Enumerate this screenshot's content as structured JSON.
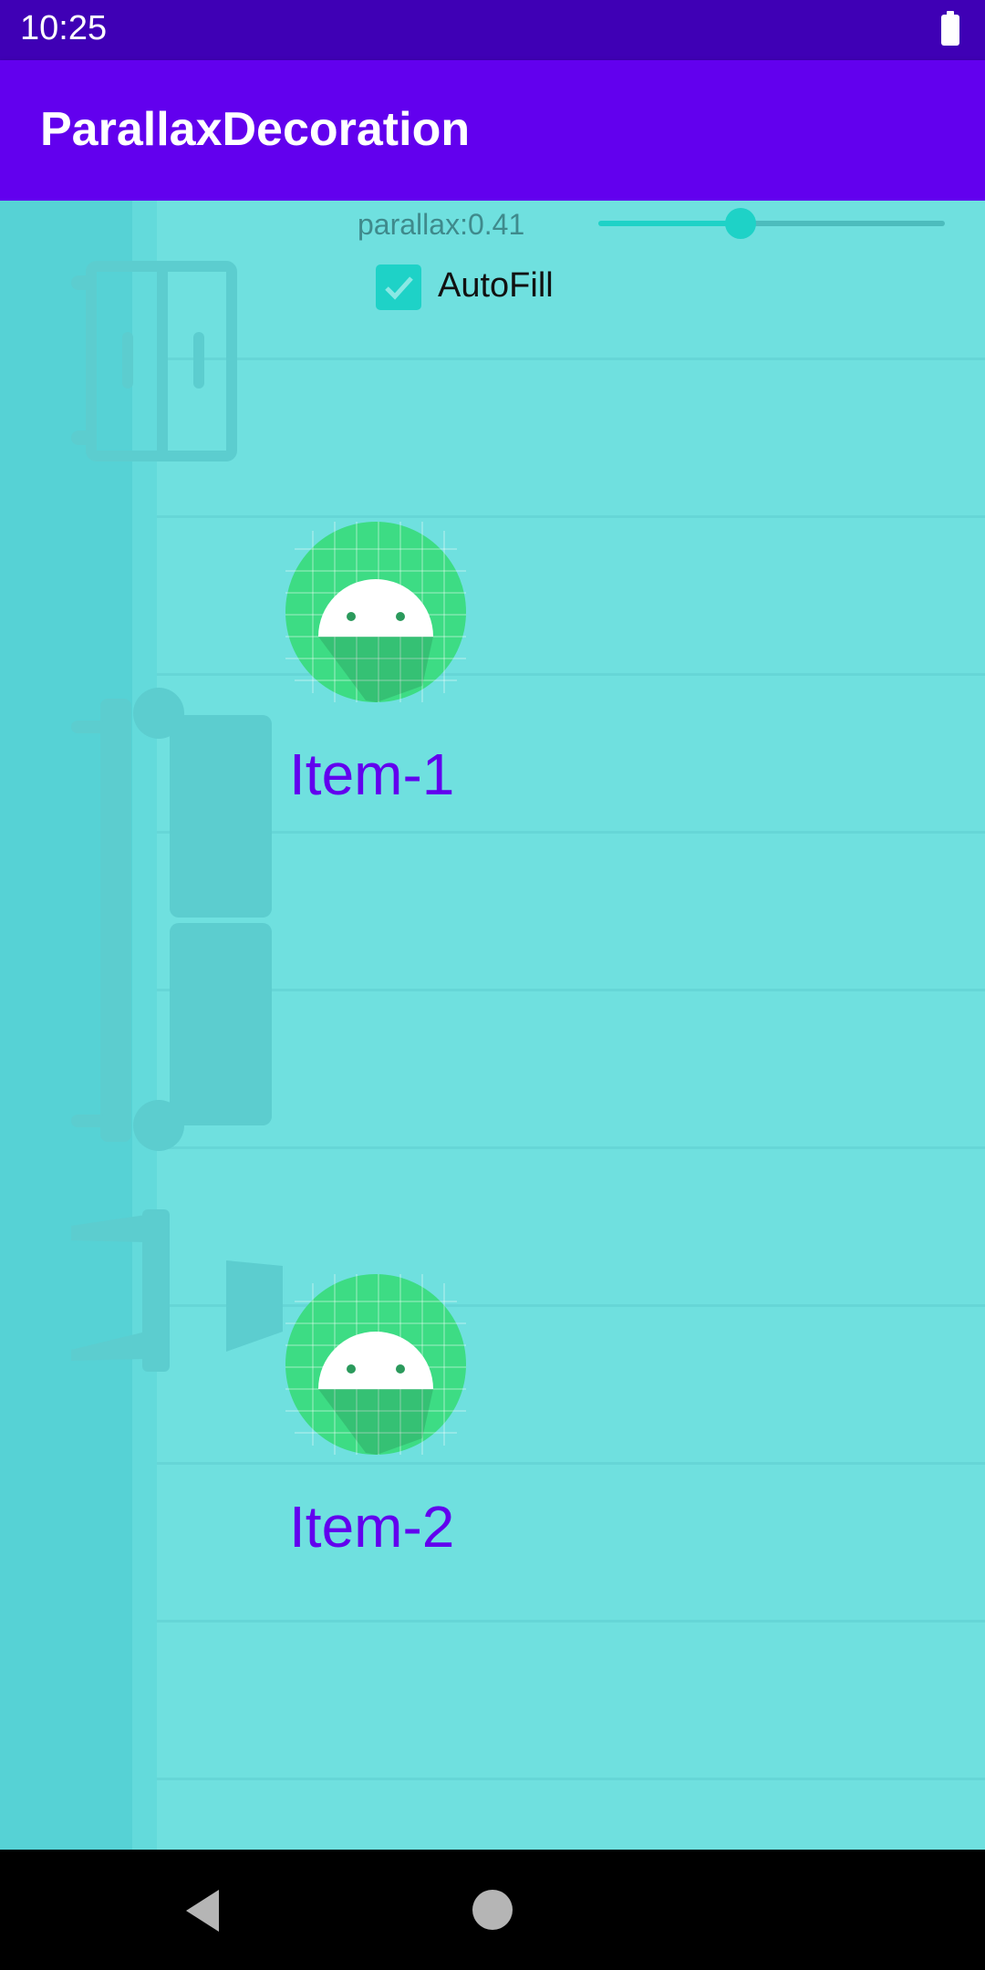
{
  "status_bar": {
    "time": "10:25"
  },
  "app_bar": {
    "title": "ParallaxDecoration"
  },
  "controls": {
    "parallax_label": "parallax:0.41",
    "parallax_value": 0.41,
    "autofill_label": "AutoFill",
    "autofill_checked": true
  },
  "items": [
    {
      "label": "Item-1"
    },
    {
      "label": "Item-2"
    }
  ],
  "colors": {
    "status_bar": "#3f00b5",
    "app_bar": "#6200ee",
    "background": "#6fe0df",
    "accent": "#1ed2c7",
    "item_text": "#6200ee"
  },
  "icons": {
    "battery": "battery-icon",
    "back": "back-triangle-icon",
    "home": "home-circle-icon",
    "item": "android-launcher-icon"
  }
}
